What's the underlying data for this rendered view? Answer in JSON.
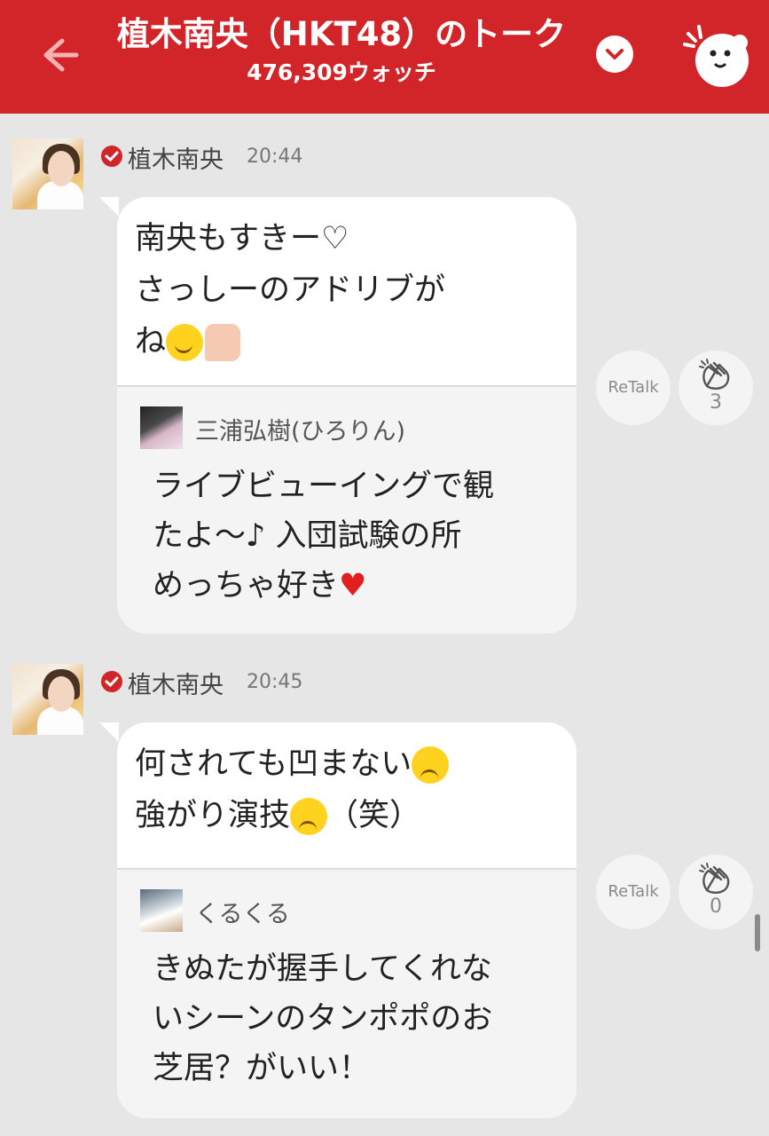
{
  "header": {
    "title": "植木南央（HKT48）のトーク",
    "watch_count": "476,309ウォッチ",
    "bg_color": "#d2252a"
  },
  "messages": [
    {
      "sender": "植木南央",
      "time": "20:44",
      "lines": [
        "南央もすきー♡",
        "さっしーのアドリブが",
        "ね"
      ],
      "reply": {
        "user": "三浦弘樹(ひろりん)",
        "lines": [
          "ライブビューイングで観",
          "たよ〜♪ 入団試験の所",
          "めっちゃ好き"
        ]
      },
      "retalk_label": "ReTalk",
      "clap_count": "3"
    },
    {
      "sender": "植木南央",
      "time": "20:45",
      "lines": [
        "何されても凹まない",
        "強がり演技",
        "（笑）"
      ],
      "reply": {
        "user": "くるくる",
        "lines": [
          "きぬたが握手してくれな",
          "いシーンのタンポポのお",
          "芝居？がいい！"
        ]
      },
      "retalk_label": "ReTalk",
      "clap_count": "0"
    }
  ]
}
